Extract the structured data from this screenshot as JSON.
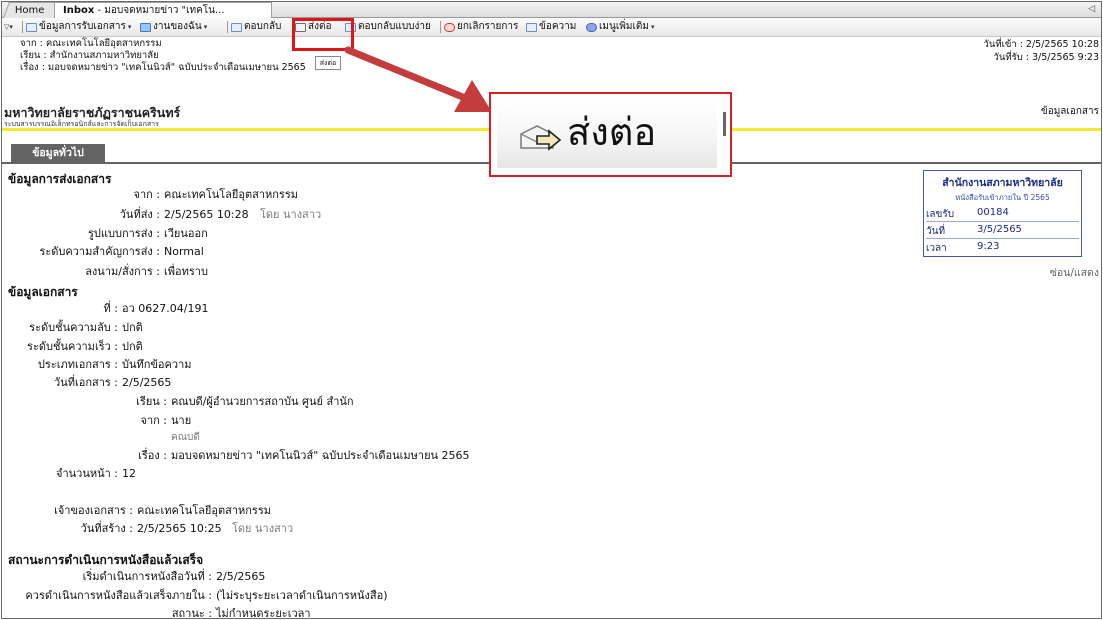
{
  "tabs": {
    "home": "Home",
    "inbox_main": "Inbox",
    "inbox_sub": " - มอบจดหมายข่าว \"เทคโน...",
    "scroll": "◁"
  },
  "toolbar": {
    "doc_info": "ข้อมูลการรับเอกสาร",
    "my_work": "งานของฉัน",
    "reply": "ตอบกลับ",
    "forward": "ส่งต่อ",
    "reply_simple": "ตอบกลับแบบง่าย",
    "cancel_item": "ยกเลิกรายการ",
    "message": "ข้อความ",
    "more_menu": "เมนูเพิ่มเติม",
    "tooltip": "ส่งต่อ"
  },
  "header": {
    "from": "จาก : คณะเทคโนโลยีอุตสาหกรรม",
    "to": "เรียน : สำนักงานสภามหาวิทยาลัย",
    "subject": "เรื่อง : มอบจดหมายข่าว \"เทคโนนิวส์\" ฉบับประจำเดือนเมษายน 2565",
    "date_in": "วันที่เข้า : 2/5/2565 10:28",
    "date_received": "วันที่รับ : 3/5/2565 9:23"
  },
  "org": {
    "title": "มหาวิทยาลัยราชภัฏราชนครินทร์",
    "subtitle": "ระบบสารบรรณอิเล็กทรอนิกส์และการจัดเก็บเอกสาร",
    "doc_label": "ข้อมูลเอกสาร",
    "general_tab": "ข้อมูลทั่วไป"
  },
  "callout": {
    "text": "ส่งต่อ"
  },
  "send_info": {
    "heading": "ข้อมูลการส่งเอกสาร",
    "from_label": "จาก :",
    "from_value": "คณะเทคโนโลยีอุตสาหกรรม",
    "sent_date_label": "วันที่ส่ง :",
    "sent_date_value": "2/5/2565 10:28",
    "sent_by": "โดย นางสาว",
    "format_label": "รูปแบบการส่ง :",
    "format_value": "เวียนออก",
    "priority_label": "ระดับความสำคัญการส่ง :",
    "priority_value": "Normal",
    "sign_label": "ลงนาม/สั่งการ :",
    "sign_value": "เพื่อทราบ"
  },
  "doc_info": {
    "heading": "ข้อมูลเอกสาร",
    "no_label": "ที่ :",
    "no_value": "อว 0627.04/191",
    "secret_label": "ระดับชั้นความลับ :",
    "secret_value": "ปกติ",
    "speed_label": "ระดับชั้นความเร็ว :",
    "speed_value": "ปกติ",
    "type_label": "ประเภทเอกสาร :",
    "type_value": "บันทึกข้อความ",
    "date_label": "วันที่เอกสาร :",
    "date_value": "2/5/2565",
    "to_label": "เรียน :",
    "to_value": "คณบดี/ผู้อำนวยการสถาบัน ศูนย์ สำนัก",
    "from_label": "จาก :",
    "from_value": "นาย",
    "from_pos": "คณบดี",
    "subject_label": "เรื่อง :",
    "subject_value": "มอบจดหมายข่าว \"เทคโนนิวส์\" ฉบับประจำเดือนเมษายน 2565",
    "pages_label": "จำนวนหน้า :",
    "pages_value": "12",
    "owner_label": "เจ้าของเอกสาร :",
    "owner_value": "คณะเทคโนโลยีอุตสาหกรรม",
    "created_label": "วันที่สร้าง :",
    "created_value": "2/5/2565 10:25",
    "created_by": "โดย นางสาว"
  },
  "status": {
    "heading": "สถานะการดำเนินการหนังสือแล้วเสร็จ",
    "start_label": "เริ่มดำเนินการหนังสือวันที่ :",
    "start_value": "2/5/2565",
    "deadline_label": "ควรดำเนินการหนังสือแล้วเสร็จภายใน :",
    "deadline_value": "(ไม่ระบุระยะเวลาดำเนินการหนังสือ)",
    "state_label": "สถานะ :",
    "state_value": "ไม่กำหนดระยะเวลา"
  },
  "receipt": {
    "title": "สำนักงานสภามหาวิทยาลัย",
    "subtitle": "หนังสือรับเข้าภายใน ปี 2565",
    "no_label": "เลขรับ",
    "no_value": "00184",
    "date_label": "วันที่",
    "date_value": "3/5/2565",
    "time_label": "เวลา",
    "time_value": "9:23",
    "toggle": "ซ่อน/แสดง"
  }
}
